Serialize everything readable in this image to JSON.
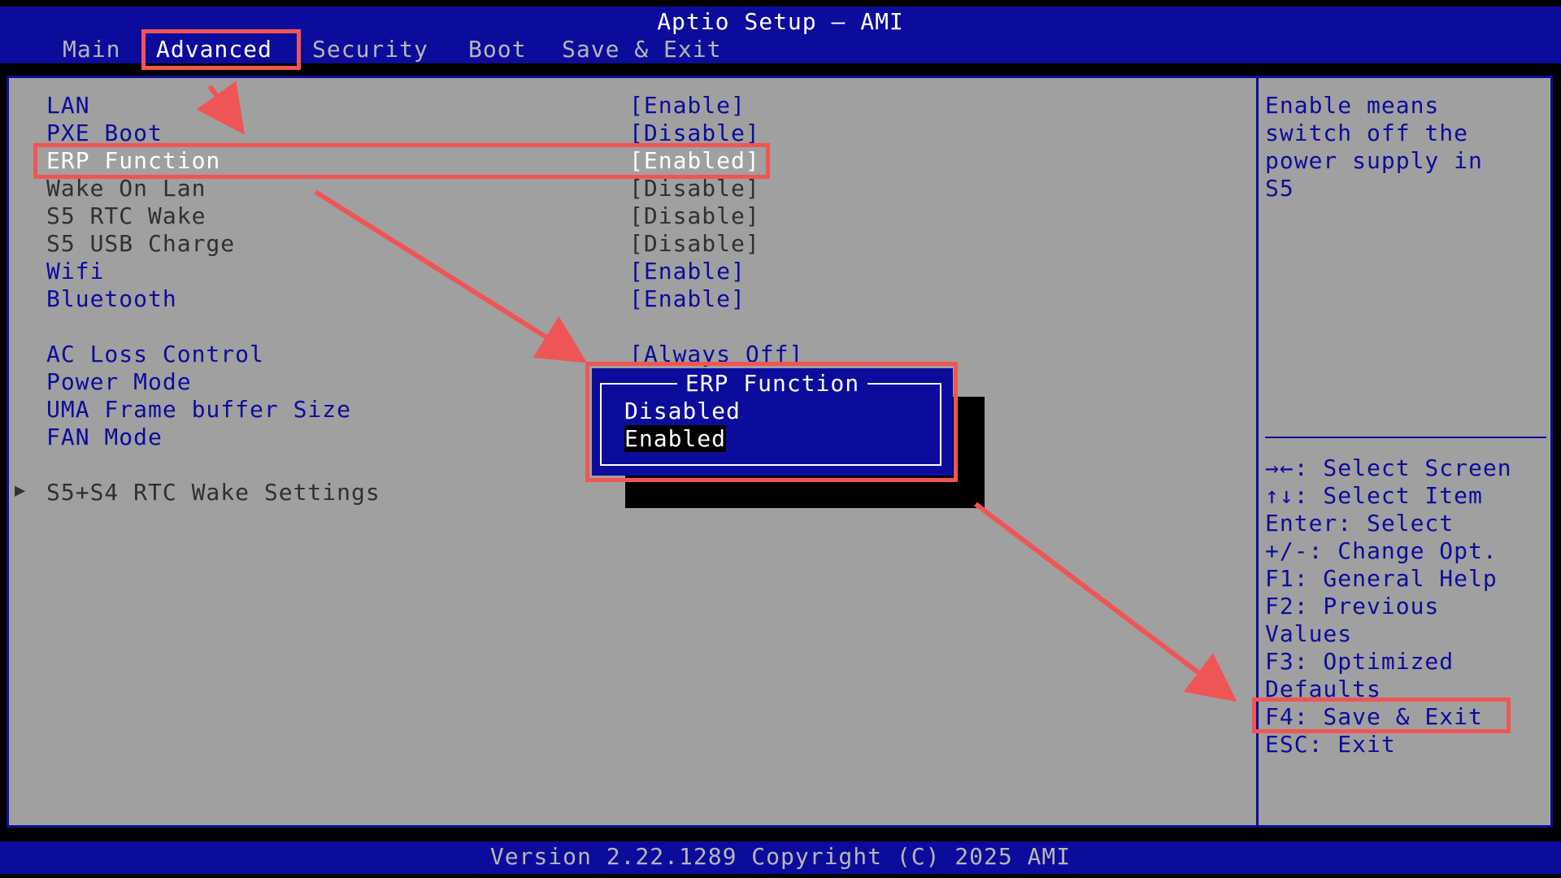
{
  "header": {
    "title": "Aptio Setup – AMI",
    "tabs": [
      "Main",
      "Advanced",
      "Security",
      "Boot",
      "Save & Exit"
    ]
  },
  "settings": [
    {
      "label": "LAN",
      "value": "[Enable]"
    },
    {
      "label": "PXE Boot",
      "value": "[Disable]"
    },
    {
      "label": "ERP Function",
      "value": "[Enabled]"
    },
    {
      "label": "Wake On Lan",
      "value": "[Disable]"
    },
    {
      "label": "S5 RTC Wake",
      "value": "[Disable]"
    },
    {
      "label": "S5 USB Charge",
      "value": "[Disable]"
    },
    {
      "label": "Wifi",
      "value": "[Enable]"
    },
    {
      "label": "Bluetooth",
      "value": "[Enable]"
    },
    {
      "label": "AC Loss Control",
      "value": "[Always Off]"
    },
    {
      "label": "Power Mode",
      "value": ""
    },
    {
      "label": "UMA Frame buffer Size",
      "value": ""
    },
    {
      "label": "FAN Mode",
      "value": ""
    }
  ],
  "submenu": {
    "marker": "▶",
    "label": "S5+S4 RTC Wake Settings"
  },
  "help": {
    "lines": [
      "Enable means",
      "switch off the",
      "power supply in",
      "S5"
    ]
  },
  "keys": [
    "→←: Select Screen",
    "↑↓: Select Item",
    "Enter: Select",
    "+/-: Change Opt.",
    "F1: General Help",
    "F2: Previous",
    "Values",
    "F3: Optimized",
    "Defaults",
    "F4: Save & Exit",
    "ESC: Exit"
  ],
  "popup": {
    "title": "ERP Function",
    "options": [
      "Disabled",
      "Enabled"
    ],
    "selected": "Enabled"
  },
  "footer": {
    "version": "Version 2.22.1289 Copyright (C) 2025 AMI"
  },
  "colors": {
    "bios_blue": "#0c0c9c",
    "panel_gray": "#a0a0a0",
    "annotation_red": "#f05555"
  }
}
